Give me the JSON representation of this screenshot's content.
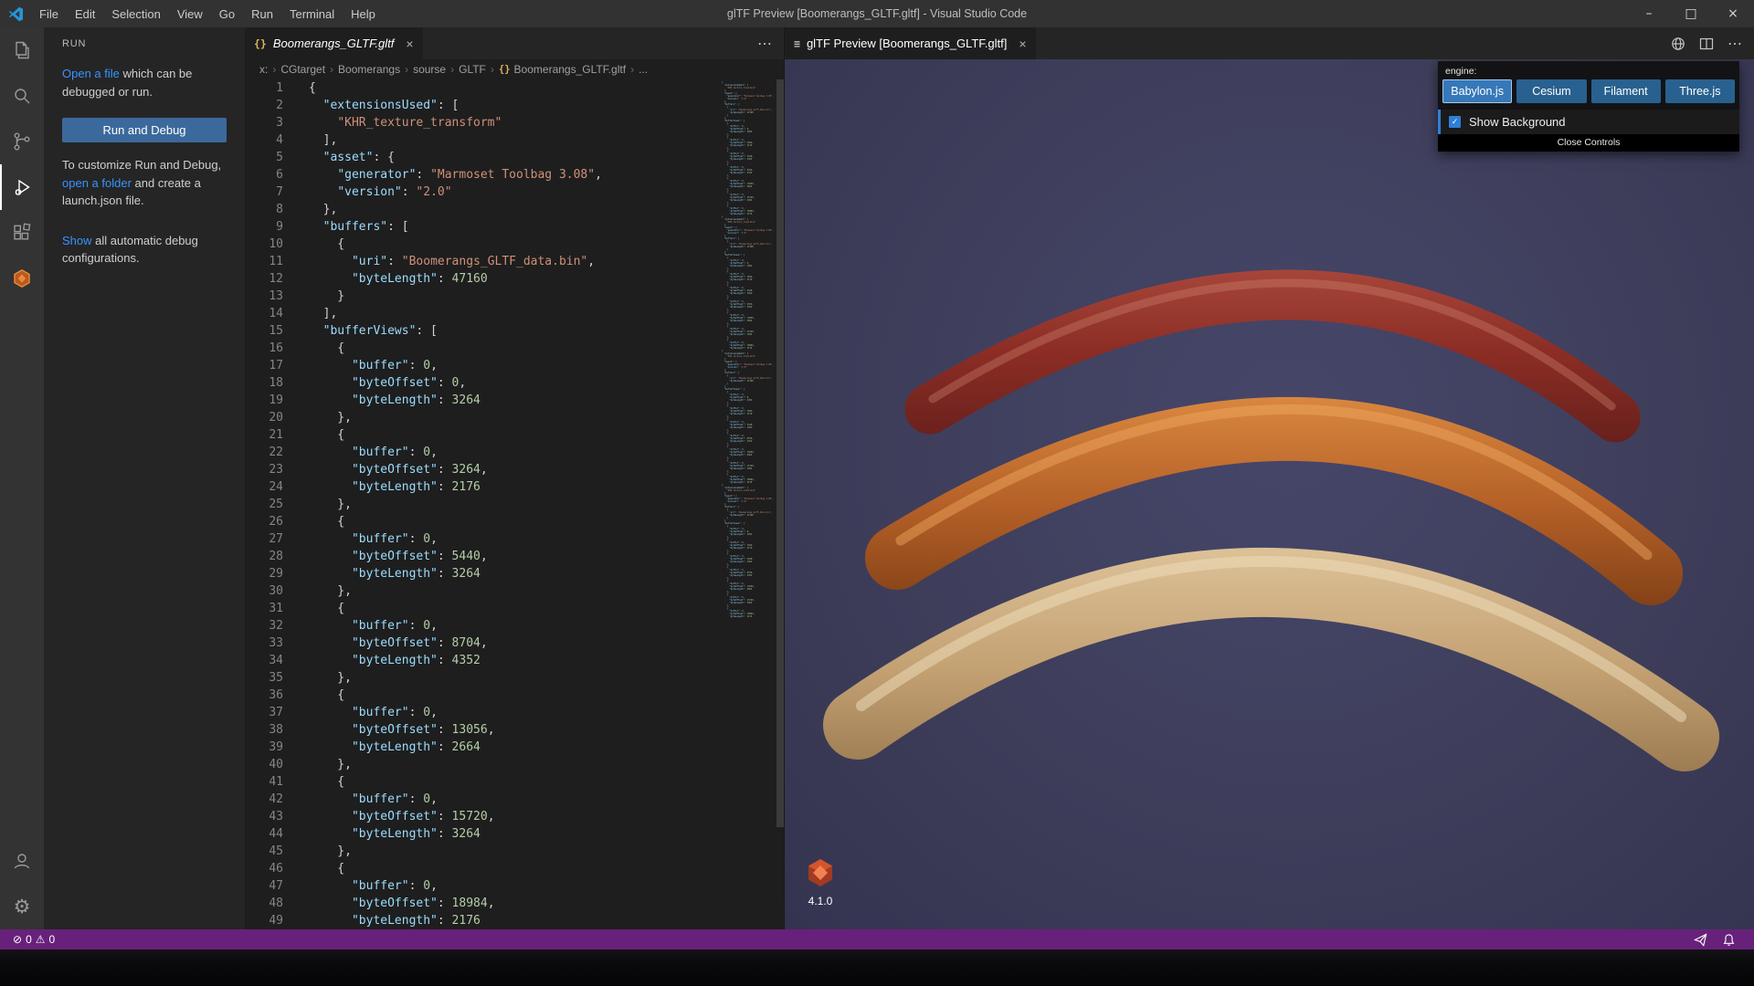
{
  "title_bar": {
    "menus": [
      "File",
      "Edit",
      "Selection",
      "View",
      "Go",
      "Run",
      "Terminal",
      "Help"
    ],
    "title": "glTF Preview [Boomerangs_GLTF.gltf] - Visual Studio Code"
  },
  "activity_bar": {
    "items": [
      "explorer",
      "search",
      "source-control",
      "run-and-debug",
      "extensions",
      "gltf-tools"
    ],
    "active": "run-and-debug",
    "bottom": [
      "accounts",
      "settings"
    ]
  },
  "sidebar": {
    "header": "RUN",
    "p1": {
      "link": "Open a file",
      "rest": " which can be debugged or run."
    },
    "run_button": "Run and Debug",
    "p2": {
      "pre": "To customize Run and Debug, ",
      "link": "open a folder",
      "post": " and create a launch.json file."
    },
    "p3": {
      "link": "Show",
      "rest": " all automatic debug configurations."
    }
  },
  "editor": {
    "tab_label": "Boomerangs_GLTF.gltf",
    "breadcrumb": [
      {
        "label": "x:"
      },
      {
        "label": "CGtarget"
      },
      {
        "label": "Boomerangs"
      },
      {
        "label": "sourse"
      },
      {
        "label": "GLTF"
      },
      {
        "label": "Boomerangs_GLTF.gltf",
        "icon": "json"
      },
      {
        "label": "..."
      }
    ],
    "code_lines": [
      [
        [
          "p",
          "{"
        ]
      ],
      [
        [
          "p",
          "  "
        ],
        [
          "k",
          "\"extensionsUsed\""
        ],
        [
          "p",
          ": ["
        ]
      ],
      [
        [
          "p",
          "    "
        ],
        [
          "s",
          "\"KHR_texture_transform\""
        ]
      ],
      [
        [
          "p",
          "  ],"
        ]
      ],
      [
        [
          "p",
          "  "
        ],
        [
          "k",
          "\"asset\""
        ],
        [
          "p",
          ": {"
        ]
      ],
      [
        [
          "p",
          "    "
        ],
        [
          "k",
          "\"generator\""
        ],
        [
          "p",
          ": "
        ],
        [
          "s",
          "\"Marmoset Toolbag 3.08\""
        ],
        [
          "p",
          ","
        ]
      ],
      [
        [
          "p",
          "    "
        ],
        [
          "k",
          "\"version\""
        ],
        [
          "p",
          ": "
        ],
        [
          "s",
          "\"2.0\""
        ]
      ],
      [
        [
          "p",
          "  },"
        ]
      ],
      [
        [
          "p",
          "  "
        ],
        [
          "k",
          "\"buffers\""
        ],
        [
          "p",
          ": ["
        ]
      ],
      [
        [
          "p",
          "    {"
        ]
      ],
      [
        [
          "p",
          "      "
        ],
        [
          "k",
          "\"uri\""
        ],
        [
          "p",
          ": "
        ],
        [
          "s",
          "\"Boomerangs_GLTF_data.bin\""
        ],
        [
          "p",
          ","
        ]
      ],
      [
        [
          "p",
          "      "
        ],
        [
          "k",
          "\"byteLength\""
        ],
        [
          "p",
          ": "
        ],
        [
          "n",
          "47160"
        ]
      ],
      [
        [
          "p",
          "    }"
        ]
      ],
      [
        [
          "p",
          "  ],"
        ]
      ],
      [
        [
          "p",
          "  "
        ],
        [
          "k",
          "\"bufferViews\""
        ],
        [
          "p",
          ": ["
        ]
      ],
      [
        [
          "p",
          "    {"
        ]
      ],
      [
        [
          "p",
          "      "
        ],
        [
          "k",
          "\"buffer\""
        ],
        [
          "p",
          ": "
        ],
        [
          "n",
          "0"
        ],
        [
          "p",
          ","
        ]
      ],
      [
        [
          "p",
          "      "
        ],
        [
          "k",
          "\"byteOffset\""
        ],
        [
          "p",
          ": "
        ],
        [
          "n",
          "0"
        ],
        [
          "p",
          ","
        ]
      ],
      [
        [
          "p",
          "      "
        ],
        [
          "k",
          "\"byteLength\""
        ],
        [
          "p",
          ": "
        ],
        [
          "n",
          "3264"
        ]
      ],
      [
        [
          "p",
          "    },"
        ]
      ],
      [
        [
          "p",
          "    {"
        ]
      ],
      [
        [
          "p",
          "      "
        ],
        [
          "k",
          "\"buffer\""
        ],
        [
          "p",
          ": "
        ],
        [
          "n",
          "0"
        ],
        [
          "p",
          ","
        ]
      ],
      [
        [
          "p",
          "      "
        ],
        [
          "k",
          "\"byteOffset\""
        ],
        [
          "p",
          ": "
        ],
        [
          "n",
          "3264"
        ],
        [
          "p",
          ","
        ]
      ],
      [
        [
          "p",
          "      "
        ],
        [
          "k",
          "\"byteLength\""
        ],
        [
          "p",
          ": "
        ],
        [
          "n",
          "2176"
        ]
      ],
      [
        [
          "p",
          "    },"
        ]
      ],
      [
        [
          "p",
          "    {"
        ]
      ],
      [
        [
          "p",
          "      "
        ],
        [
          "k",
          "\"buffer\""
        ],
        [
          "p",
          ": "
        ],
        [
          "n",
          "0"
        ],
        [
          "p",
          ","
        ]
      ],
      [
        [
          "p",
          "      "
        ],
        [
          "k",
          "\"byteOffset\""
        ],
        [
          "p",
          ": "
        ],
        [
          "n",
          "5440"
        ],
        [
          "p",
          ","
        ]
      ],
      [
        [
          "p",
          "      "
        ],
        [
          "k",
          "\"byteLength\""
        ],
        [
          "p",
          ": "
        ],
        [
          "n",
          "3264"
        ]
      ],
      [
        [
          "p",
          "    },"
        ]
      ],
      [
        [
          "p",
          "    {"
        ]
      ],
      [
        [
          "p",
          "      "
        ],
        [
          "k",
          "\"buffer\""
        ],
        [
          "p",
          ": "
        ],
        [
          "n",
          "0"
        ],
        [
          "p",
          ","
        ]
      ],
      [
        [
          "p",
          "      "
        ],
        [
          "k",
          "\"byteOffset\""
        ],
        [
          "p",
          ": "
        ],
        [
          "n",
          "8704"
        ],
        [
          "p",
          ","
        ]
      ],
      [
        [
          "p",
          "      "
        ],
        [
          "k",
          "\"byteLength\""
        ],
        [
          "p",
          ": "
        ],
        [
          "n",
          "4352"
        ]
      ],
      [
        [
          "p",
          "    },"
        ]
      ],
      [
        [
          "p",
          "    {"
        ]
      ],
      [
        [
          "p",
          "      "
        ],
        [
          "k",
          "\"buffer\""
        ],
        [
          "p",
          ": "
        ],
        [
          "n",
          "0"
        ],
        [
          "p",
          ","
        ]
      ],
      [
        [
          "p",
          "      "
        ],
        [
          "k",
          "\"byteOffset\""
        ],
        [
          "p",
          ": "
        ],
        [
          "n",
          "13056"
        ],
        [
          "p",
          ","
        ]
      ],
      [
        [
          "p",
          "      "
        ],
        [
          "k",
          "\"byteLength\""
        ],
        [
          "p",
          ": "
        ],
        [
          "n",
          "2664"
        ]
      ],
      [
        [
          "p",
          "    },"
        ]
      ],
      [
        [
          "p",
          "    {"
        ]
      ],
      [
        [
          "p",
          "      "
        ],
        [
          "k",
          "\"buffer\""
        ],
        [
          "p",
          ": "
        ],
        [
          "n",
          "0"
        ],
        [
          "p",
          ","
        ]
      ],
      [
        [
          "p",
          "      "
        ],
        [
          "k",
          "\"byteOffset\""
        ],
        [
          "p",
          ": "
        ],
        [
          "n",
          "15720"
        ],
        [
          "p",
          ","
        ]
      ],
      [
        [
          "p",
          "      "
        ],
        [
          "k",
          "\"byteLength\""
        ],
        [
          "p",
          ": "
        ],
        [
          "n",
          "3264"
        ]
      ],
      [
        [
          "p",
          "    },"
        ]
      ],
      [
        [
          "p",
          "    {"
        ]
      ],
      [
        [
          "p",
          "      "
        ],
        [
          "k",
          "\"buffer\""
        ],
        [
          "p",
          ": "
        ],
        [
          "n",
          "0"
        ],
        [
          "p",
          ","
        ]
      ],
      [
        [
          "p",
          "      "
        ],
        [
          "k",
          "\"byteOffset\""
        ],
        [
          "p",
          ": "
        ],
        [
          "n",
          "18984"
        ],
        [
          "p",
          ","
        ]
      ],
      [
        [
          "p",
          "      "
        ],
        [
          "k",
          "\"byteLength\""
        ],
        [
          "p",
          ": "
        ],
        [
          "n",
          "2176"
        ]
      ]
    ]
  },
  "preview": {
    "tab_label": "glTF Preview [Boomerangs_GLTF.gltf]",
    "engine_label": "engine:",
    "engines": [
      {
        "label": "Babylon.js",
        "selected": true
      },
      {
        "label": "Cesium",
        "selected": false
      },
      {
        "label": "Filament",
        "selected": false
      },
      {
        "label": "Three.js",
        "selected": false
      }
    ],
    "show_background": "Show Background",
    "close_controls": "Close Controls",
    "version": "4.1.0"
  },
  "status_bar": {
    "errors": "0",
    "warnings": "0"
  },
  "icons": {
    "minimize": "–",
    "maximize": "□",
    "close": "×",
    "tab_close": "×",
    "more": "⋯",
    "chevron": "›",
    "json_brackets": "{}",
    "preview_tab": "≡",
    "error": "⊘",
    "warning": "⚠",
    "check": "✓",
    "gear": "⚙"
  },
  "colors": {
    "status_bar": "#68217a",
    "title_bar": "#323233",
    "editor_bg": "#1e1e1e",
    "preview_bg": "#3e3e5b",
    "engine_button": "#28618f",
    "engine_button_selected": "#3678b8",
    "link": "#3794ff",
    "json_key": "#9cdcfe",
    "json_string": "#ce9178",
    "json_number": "#b5cea8",
    "boomerang_top": "#8c2d25",
    "boomerang_middle": "#b35f27",
    "boomerang_bottom": "#c3a173"
  }
}
